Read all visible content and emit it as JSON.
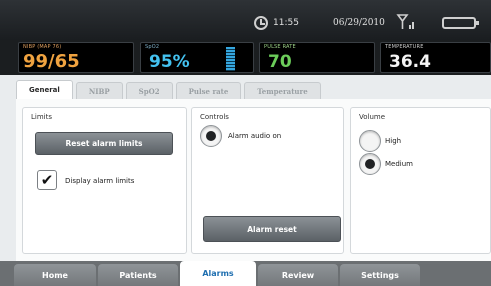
{
  "status": {
    "time": "11:55",
    "date": "06/29/2010",
    "icons": [
      "clock-icon",
      "signal-icon",
      "battery-icon"
    ]
  },
  "vitals": {
    "nibp": {
      "label": "NIBP (MAP 76)",
      "value": "99/65"
    },
    "spo2": {
      "label": "SpO2",
      "value": "95%"
    },
    "pulse": {
      "label": "PULSE RATE",
      "value": "70"
    },
    "temp": {
      "label": "TEMPERATURE",
      "value": "36.4"
    }
  },
  "tabs": [
    "General",
    "NIBP",
    "SpO2",
    "Pulse rate",
    "Temperature"
  ],
  "active_tab": "General",
  "limits": {
    "title": "Limits",
    "reset_label": "Reset alarm limits",
    "display_label": "Display alarm limits",
    "display_checked": true
  },
  "controls": {
    "title": "Controls",
    "audio_label": "Alarm audio on",
    "audio_on": true,
    "reset_label": "Alarm reset"
  },
  "volume": {
    "title": "Volume",
    "options": [
      "High",
      "Medium"
    ],
    "selected": "Medium"
  },
  "nav": {
    "items": [
      "Home",
      "Patients",
      "Alarms",
      "Review",
      "Settings"
    ],
    "active": "Alarms"
  },
  "colors": {
    "nibp": "#f0a340",
    "spo2": "#44c2f0",
    "pulse": "#6ccd5a",
    "temp": "#f5f5f5",
    "active_nav": "#1f6fb0"
  }
}
